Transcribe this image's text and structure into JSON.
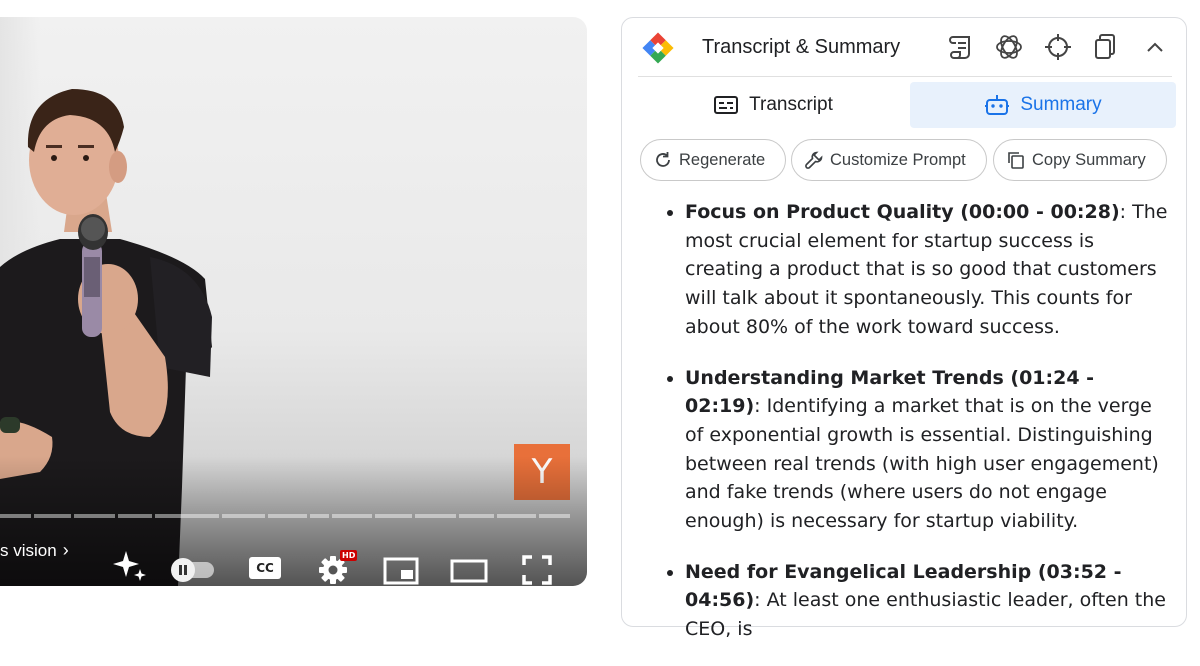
{
  "player": {
    "logo_letter": "Y",
    "chapter_text": "s vision",
    "chapter_chevron": "›",
    "hd_badge": "HD",
    "cc_label": "CC",
    "progress_segments": 14,
    "icons": [
      "chevron-right-icon",
      "sparkle-icon",
      "autoplay-toggle-icon",
      "captions-icon",
      "settings-icon",
      "miniplayer-icon",
      "theater-mode-icon",
      "fullscreen-icon"
    ]
  },
  "panel": {
    "title": "Transcript & Summary",
    "header_icons": [
      "scroll-icon",
      "openai-icon",
      "crosshair-icon",
      "copy-icon",
      "chevron-up-icon"
    ],
    "tabs": [
      {
        "label": "Transcript",
        "icon": "transcript-icon",
        "active": false
      },
      {
        "label": "Summary",
        "icon": "robot-icon",
        "active": true
      }
    ],
    "actions": [
      {
        "label": "Regenerate",
        "icon": "refresh-icon"
      },
      {
        "label": "Customize Prompt",
        "icon": "wrench-icon"
      },
      {
        "label": "Copy Summary",
        "icon": "copy-icon"
      }
    ],
    "summary_items": [
      {
        "heading": "Focus on Product Quality (00:00 - 00:28)",
        "body": ": The most crucial element for startup success is creating a product that is so good that customers will talk about it spontaneously. This counts for about 80% of the work toward success."
      },
      {
        "heading": "Understanding Market Trends (01:24 - 02:19)",
        "body": ": Identifying a market that is on the verge of exponential growth is essential. Distinguishing between real trends (with high user engagement) and fake trends (where users do not engage enough) is necessary for startup viability."
      },
      {
        "heading": "Need for Evangelical Leadership (03:52 - 04:56)",
        "body": ": At least one enthusiastic leader, often the CEO, is"
      }
    ]
  },
  "colors": {
    "accent": "#1a73e8",
    "active_tab_bg": "#e8f1fc",
    "yc_orange": "#e8703a",
    "hd_badge": "#cc0000"
  }
}
